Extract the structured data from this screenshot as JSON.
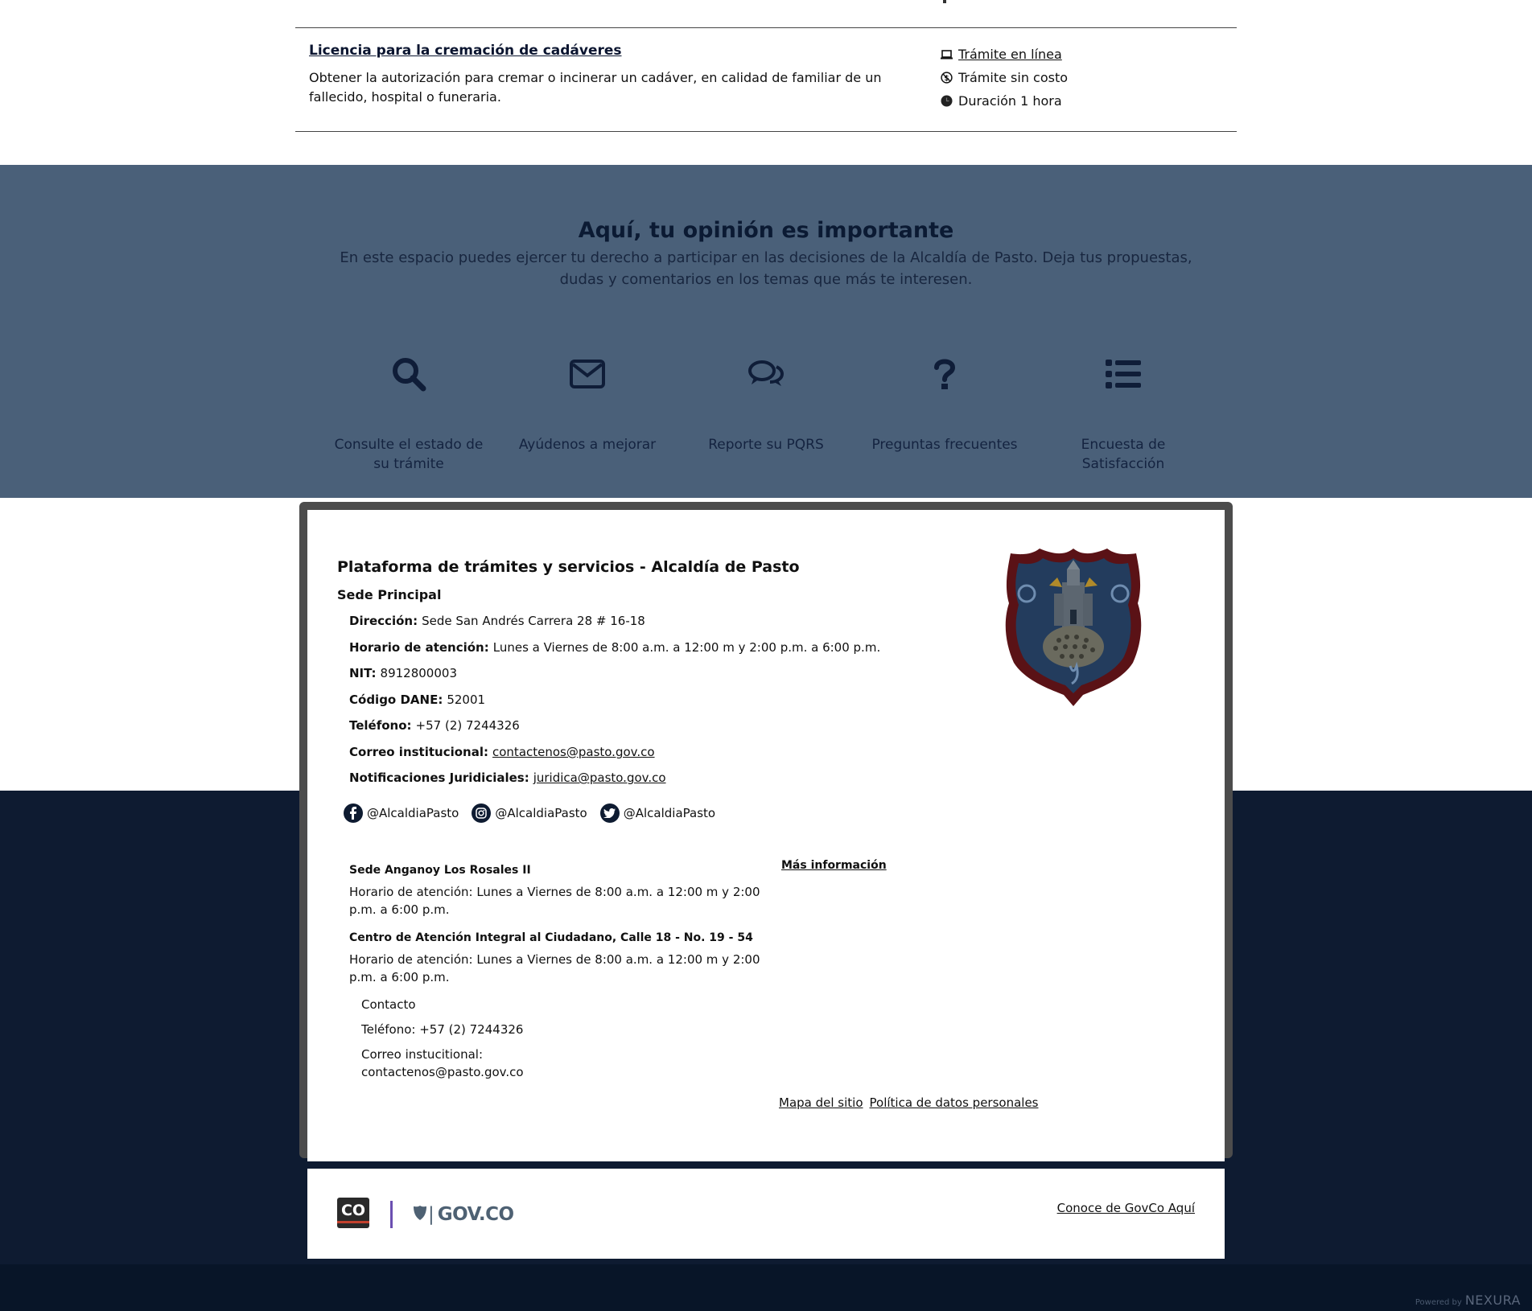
{
  "tramite": {
    "title": "Licencia para la cremación de cadáveres",
    "description": "Obtener la autorización para cremar o incinerar un cadáver, en calidad de familiar de un fallecido, hospital o funeraria.",
    "meta": {
      "online": "Trámite en línea",
      "free": "Trámite sin costo",
      "duration": "Duración 1 hora"
    }
  },
  "opinion": {
    "title": "Aquí, tu opinión es importante",
    "subtitle": "En este espacio puedes ejercer tu derecho a participar en las decisiones de la Alcaldía de Pasto. Deja tus propuestas, dudas y comentarios en los temas que más te interesen.",
    "items": [
      {
        "label": "Consulte el estado de su trámite",
        "icon": "search-icon"
      },
      {
        "label": "Ayúdenos a mejorar",
        "icon": "envelope-icon"
      },
      {
        "label": "Reporte su PQRS",
        "icon": "chat-icon"
      },
      {
        "label": "Preguntas frecuentes",
        "icon": "question-icon"
      },
      {
        "label": "Encuesta de Satisfacción",
        "icon": "list-icon"
      }
    ]
  },
  "footer": {
    "title": "Plataforma de trámites y servicios - Alcaldía de Pasto",
    "sede_principal": "Sede Principal",
    "info": [
      {
        "label": "Dirección:",
        "value": "Sede San Andrés Carrera 28 # 16-18"
      },
      {
        "label": "Horario de atención:",
        "value": "Lunes a Viernes de 8:00 a.m. a 12:00 m y 2:00 p.m. a 6:00 p.m."
      },
      {
        "label": "NIT:",
        "value": "8912800003"
      },
      {
        "label": "Código DANE:",
        "value": "52001"
      },
      {
        "label": "Teléfono:",
        "value": "+57 (2) 7244326"
      },
      {
        "label": "Correo institucional:",
        "value": "contactenos@pasto.gov.co"
      },
      {
        "label": "Notificaciones Juridiciales:",
        "value": "juridica@pasto.gov.co"
      }
    ],
    "socials": {
      "facebook": "@AlcaldiaPasto",
      "instagram": "@AlcaldiaPasto",
      "twitter": "@AlcaldiaPasto"
    },
    "sede2_title": "Sede Anganoy Los Rosales II",
    "sede2_hours": "Horario de atención: Lunes a Viernes de 8:00 a.m. a 12:00 m y 2:00 p.m. a 6:00 p.m.",
    "caic_title": "Centro de Atención Integral al Ciudadano, Calle 18 - No. 19 - 54",
    "caic_hours": "Horario de atención: Lunes a Viernes de 8:00 a.m. a 12:00 m y 2:00 p.m. a 6:00 p.m.",
    "contact_title": "Contacto",
    "contact_phone": "Teléfono: +57 (2) 7244326",
    "contact_email": "Correo instucitional: contactenos@pasto.gov.co",
    "mas_info": "Más información",
    "links": {
      "sitemap": "Mapa del sitio",
      "privacy": "Política de datos personales"
    }
  },
  "govco": {
    "co_logo": "CO",
    "govco_text": "GOV.CO",
    "conoce": "Conoce de GovCo Aquí"
  },
  "powered": {
    "label": "Powered by",
    "brand": "NEXURA"
  },
  "colors": {
    "opinion_bg": "#4a6079",
    "dark_bg": "#0e1b31",
    "accent_purple": "#6b4fb1"
  }
}
